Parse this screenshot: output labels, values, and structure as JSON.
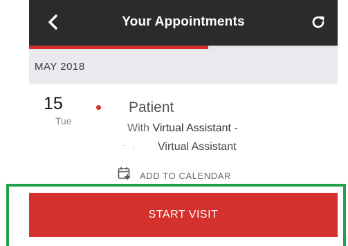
{
  "header": {
    "title": "Your Appointments",
    "back_icon": "chevron-left-icon",
    "refresh_icon": "refresh-icon"
  },
  "progress": {
    "fraction": 0.58,
    "color": "#d4312e"
  },
  "month_section": {
    "label": "MAY 2018"
  },
  "appointment": {
    "day_number": "15",
    "day_name": "Tue",
    "status_dot_color": "#d4312e",
    "title": "Patient",
    "with_prefix": "With",
    "provider": "Virtual Assistant -",
    "provider_line2": "Virtual Assistant",
    "add_to_calendar_label": "ADD TO CALENDAR"
  },
  "actions": {
    "start_visit_label": "START VISIT"
  },
  "colors": {
    "accent": "#d4312e",
    "header_bg": "#2b2b2b",
    "highlight": "#1fa34a"
  }
}
